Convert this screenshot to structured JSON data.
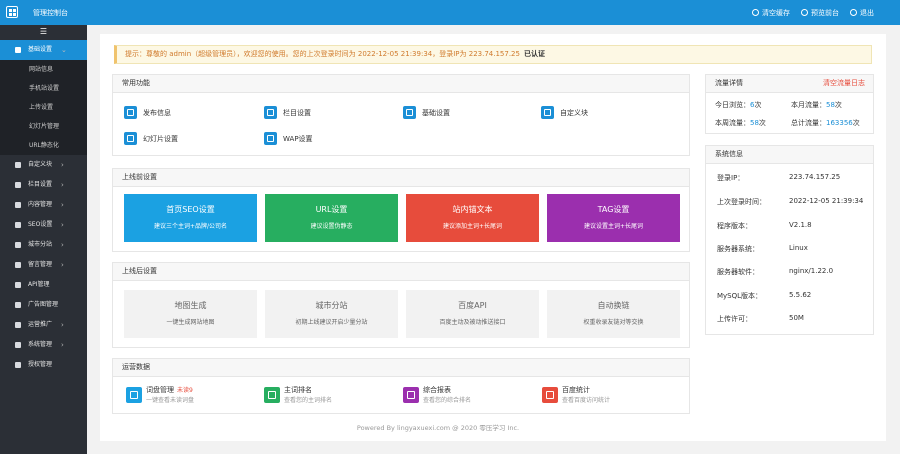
{
  "topbar": {
    "title": "管理控制台",
    "actions": [
      {
        "label": "清空缓存",
        "icon": "refresh-icon"
      },
      {
        "label": "预览前台",
        "icon": "eye-icon"
      },
      {
        "label": "退出",
        "icon": "power-icon"
      }
    ]
  },
  "sidebar": {
    "toggle": "☰",
    "active": {
      "label": "基础设置",
      "icon": "gear-icon",
      "arrow": "⌄"
    },
    "subitems": [
      "网站信息",
      "手机站设置",
      "上传设置",
      "幻灯片管理",
      "URL静态化"
    ],
    "items": [
      {
        "label": "自定义块",
        "icon": "tag-icon",
        "arrow": "›"
      },
      {
        "label": "栏目设置",
        "icon": "grid-icon",
        "arrow": "›"
      },
      {
        "label": "内容管理",
        "icon": "edit-icon",
        "arrow": "›"
      },
      {
        "label": "SEO设置",
        "icon": "chart-icon",
        "arrow": "›"
      },
      {
        "label": "城市分站",
        "icon": "globe-icon",
        "arrow": "›"
      },
      {
        "label": "留言管理",
        "icon": "comment-icon",
        "arrow": "›"
      },
      {
        "label": "API管理",
        "icon": "key-icon",
        "arrow": ""
      },
      {
        "label": "广告图管理",
        "icon": "image-icon",
        "arrow": ""
      },
      {
        "label": "运营推广",
        "icon": "megaphone-icon",
        "arrow": "›"
      },
      {
        "label": "系统管理",
        "icon": "monitor-icon",
        "arrow": "›"
      },
      {
        "label": "授权管理",
        "icon": "cloud-icon",
        "arrow": ""
      }
    ]
  },
  "notice": {
    "text": "提示：尊敬的 admin（超级管理员），欢迎您的使用。您的上次登录时间为 2022-12-05 21:39:34，登录IP为 223.74.157.25",
    "status": "已认证"
  },
  "common_functions": {
    "title": "常用功能",
    "items": [
      {
        "label": "发布信息",
        "icon": "share-icon"
      },
      {
        "label": "栏目设置",
        "icon": "list-icon"
      },
      {
        "label": "基础设置",
        "icon": "gear-icon"
      },
      {
        "label": "自定义块",
        "icon": "pen-icon"
      },
      {
        "label": "幻灯片设置",
        "icon": "upload-icon"
      },
      {
        "label": "WAP设置",
        "icon": "gear-icon"
      }
    ]
  },
  "pre_launch": {
    "title": "上线前设置",
    "cards": [
      {
        "title": "首页SEO设置",
        "sub": "建议三个主词+品牌/公司名",
        "color": "#1ba1e2"
      },
      {
        "title": "URL设置",
        "sub": "建议设置伪静态",
        "color": "#27ae60"
      },
      {
        "title": "站内锚文本",
        "sub": "建议添加主词+长尾词",
        "color": "#e74c3c"
      },
      {
        "title": "TAG设置",
        "sub": "建议设置主词+长尾词",
        "color": "#9b2fae"
      }
    ]
  },
  "post_launch": {
    "title": "上线后设置",
    "cards": [
      {
        "title": "地图生成",
        "sub": "一键生成网站地图"
      },
      {
        "title": "城市分站",
        "sub": "初期上线建议开启少量分站"
      },
      {
        "title": "百度API",
        "sub": "百度主动及被动推送接口"
      },
      {
        "title": "自动换链",
        "sub": "权重收录友链对等交换"
      }
    ]
  },
  "operations": {
    "title": "运营数据",
    "items": [
      {
        "title": "词盘管理",
        "badge": "未读9",
        "sub": "一键查看未读词盘",
        "color": "#1ba1e2",
        "icon": "inbox-icon"
      },
      {
        "title": "主词排名",
        "badge": "",
        "sub": "查看您的主词排名",
        "color": "#27ae60",
        "icon": "bar-chart-icon"
      },
      {
        "title": "综合报表",
        "badge": "",
        "sub": "查看您的综合排名",
        "color": "#9b2fae",
        "icon": "link-icon"
      },
      {
        "title": "百度统计",
        "badge": "",
        "sub": "查看百度访问统计",
        "color": "#e74c3c",
        "icon": "document-icon"
      }
    ]
  },
  "footer": {
    "text": "Powered By lingyaxuexi.com @ 2020 零压学习 Inc."
  },
  "traffic": {
    "title": "流量详情",
    "clear": "清空流量日志",
    "today_label": "今日浏览：",
    "today_value": "6",
    "today_unit": "次",
    "month_label": "本月流量：",
    "month_value": "58",
    "month_unit": "次",
    "week_label": "本周流量：",
    "week_value": "58",
    "week_unit": "次",
    "total_label": "总计流量：",
    "total_value": "163356",
    "total_unit": "次"
  },
  "system": {
    "title": "系统信息",
    "rows": [
      {
        "label": "登录IP：",
        "value": "223.74.157.25"
      },
      {
        "label": "上次登录时间：",
        "value": "2022-12-05 21:39:34"
      },
      {
        "label": "程序版本：",
        "value": "V2.1.8"
      },
      {
        "label": "服务器系统：",
        "value": "Linux"
      },
      {
        "label": "服务器软件：",
        "value": "nginx/1.22.0"
      },
      {
        "label": "MySQL版本：",
        "value": "5.5.62"
      },
      {
        "label": "上传许可：",
        "value": "50M"
      }
    ]
  }
}
